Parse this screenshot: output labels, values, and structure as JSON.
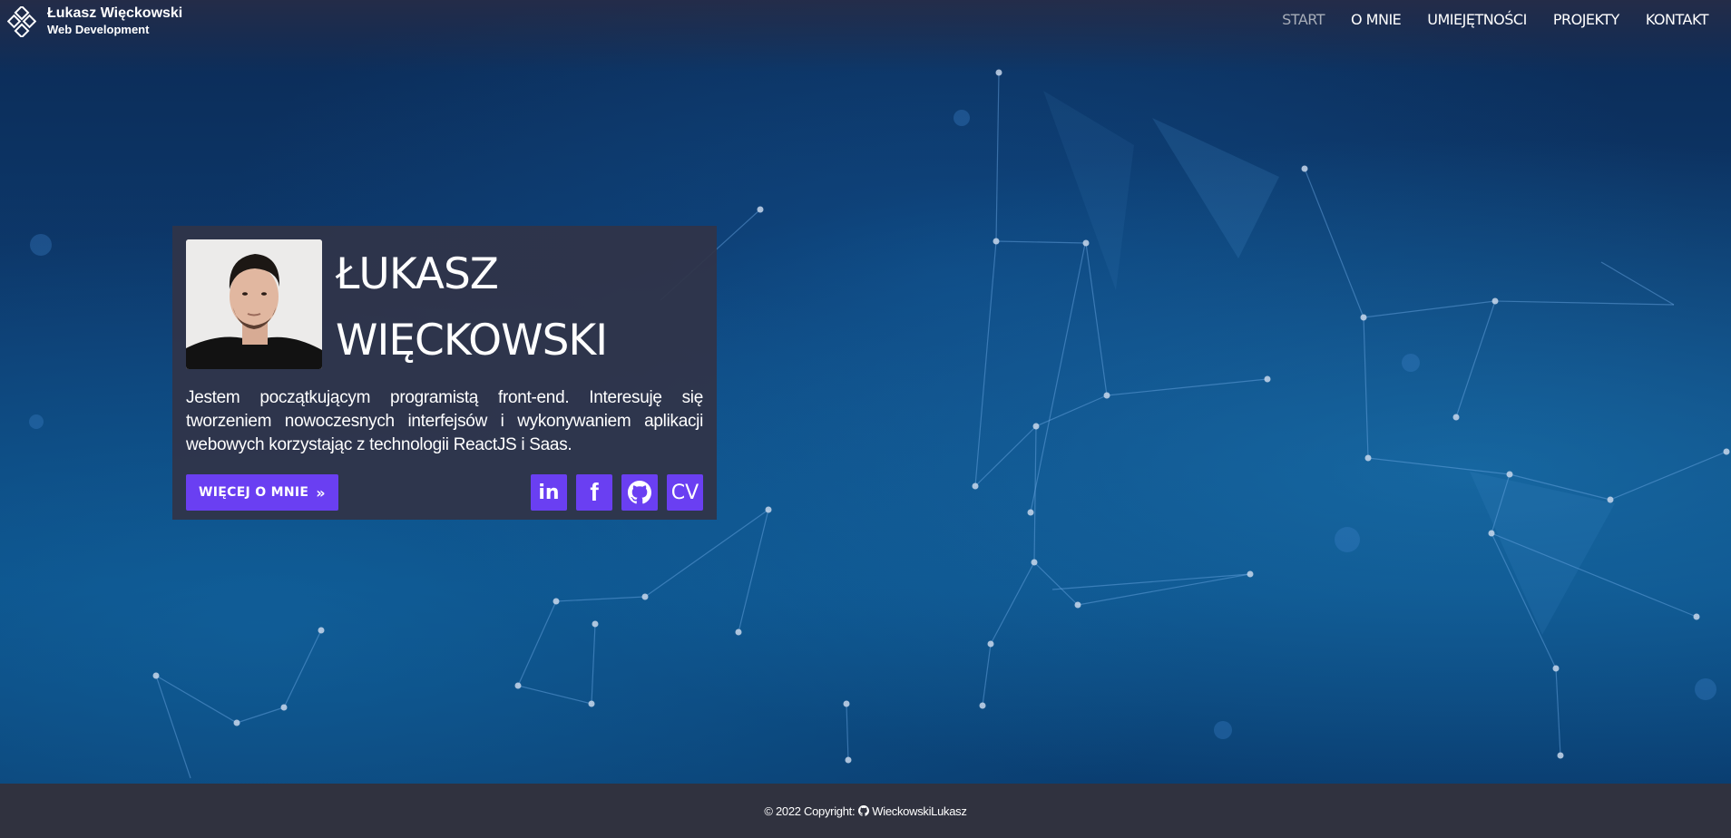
{
  "header": {
    "brand_name": "Łukasz Więckowski",
    "brand_sub": "Web Development",
    "nav": [
      {
        "label": "START",
        "active": true
      },
      {
        "label": "O MNIE",
        "active": false
      },
      {
        "label": "UMIEJĘTNOŚCI",
        "active": false
      },
      {
        "label": "PROJEKTY",
        "active": false
      },
      {
        "label": "KONTAKT",
        "active": false
      }
    ]
  },
  "hero": {
    "name_line1": "ŁUKASZ",
    "name_line2": "WIĘCKOWSKI",
    "bio": "Jestem początkującym programistą front-end. Interesuję się tworzeniem nowoczesnych interfejsów i wykonywaniem aplikacji webowych korzystając z technologii ReactJS i Saas.",
    "more_button": "WIĘCEJ O MNIE",
    "socials": [
      {
        "icon": "linkedin-icon",
        "label": "in"
      },
      {
        "icon": "facebook-icon",
        "label": "f"
      },
      {
        "icon": "github-icon",
        "label": ""
      },
      {
        "icon": "cv-icon",
        "label": "CV"
      }
    ]
  },
  "footer": {
    "copyright": "© 2022 Copyright:",
    "author": "WieckowskiLukasz"
  },
  "colors": {
    "accent": "#6a3ff2",
    "footer_bg": "#30323f",
    "card_bg": "#303448"
  }
}
